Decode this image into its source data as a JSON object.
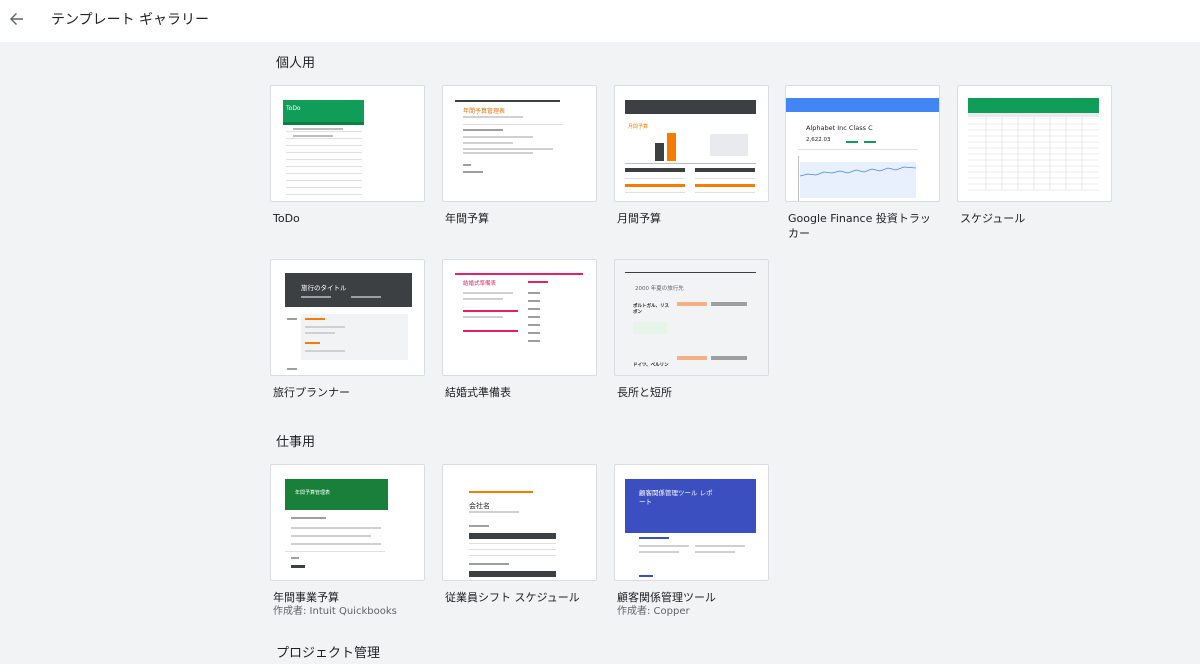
{
  "header": {
    "title": "テンプレート ギャラリー"
  },
  "sections": [
    {
      "title": "個人用",
      "cards": [
        {
          "name": "ToDo",
          "thumb_text": "ToDo"
        },
        {
          "name": "年間予算",
          "thumb_text": "年間予算管理表"
        },
        {
          "name": "月間予算",
          "thumb_text": "月間予算"
        },
        {
          "name": "Google Finance 投資トラッカー",
          "thumb_text": "Alphabet Inc Class C",
          "thumb_value": "2,622.03"
        },
        {
          "name": "スケジュール"
        },
        {
          "name": "旅行プランナー",
          "thumb_text": "旅行のタイトル"
        },
        {
          "name": "結婚式準備表",
          "thumb_text": "結婚式準備表"
        },
        {
          "name": "長所と短所",
          "thumb_text": "2000 年夏の旅行先",
          "thumb_items": [
            "ポルトガル、リスボン",
            "ドイツ、ベルリン"
          ]
        }
      ]
    },
    {
      "title": "仕事用",
      "cards": [
        {
          "name": "年間事業予算",
          "author": "作成者: Intuit Quickbooks",
          "thumb_text": "年間予算管理表"
        },
        {
          "name": "従業員シフト スケジュール",
          "thumb_text": "会社名"
        },
        {
          "name": "顧客関係管理ツール",
          "author": "作成者: Copper",
          "thumb_text": "顧客関係管理ツール レポート"
        }
      ]
    },
    {
      "title": "プロジェクト管理"
    }
  ],
  "colors": {
    "todo_green": "#0f9d58",
    "finance_blue": "#4285f4",
    "business_green": "#188038",
    "crm_blue": "#3c4fc1",
    "wedding_pink": "#e91e63",
    "budget_orange": "#f57c00",
    "dark_header": "#3c4043"
  },
  "icons": {
    "back": "arrow-left-icon"
  }
}
